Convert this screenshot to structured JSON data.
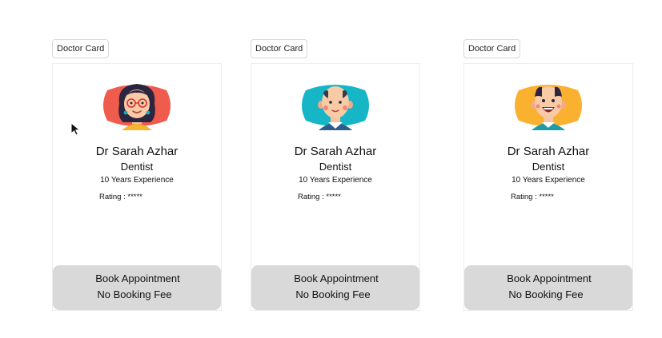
{
  "cards": [
    {
      "tag": "Doctor Card",
      "avatar_icon": "female-doctor-avatar-icon",
      "avatar_bg": "#ef5b4c",
      "name": "Dr Sarah Azhar",
      "specialty": "Dentist",
      "experience": "10 Years Experience",
      "rating": "Rating : *****",
      "button_line1": "Book Appointment",
      "button_line2": "No Booking Fee"
    },
    {
      "tag": "Doctor Card",
      "avatar_icon": "bald-male-doctor-avatar-icon",
      "avatar_bg": "#17b6c6",
      "name": "Dr Sarah Azhar",
      "specialty": "Dentist",
      "experience": "10 Years Experience",
      "rating": "Rating : *****",
      "button_line1": "Book Appointment",
      "button_line2": "No Booking Fee"
    },
    {
      "tag": "Doctor Card",
      "avatar_icon": "smiling-male-doctor-avatar-icon",
      "avatar_bg": "#fbb130",
      "name": "Dr Sarah Azhar",
      "specialty": "Dentist",
      "experience": "10 Years Experience",
      "rating": "Rating : *****",
      "button_line1": "Book Appointment",
      "button_line2": "No Booking Fee"
    }
  ],
  "cursor_icon": "mouse-pointer-icon"
}
